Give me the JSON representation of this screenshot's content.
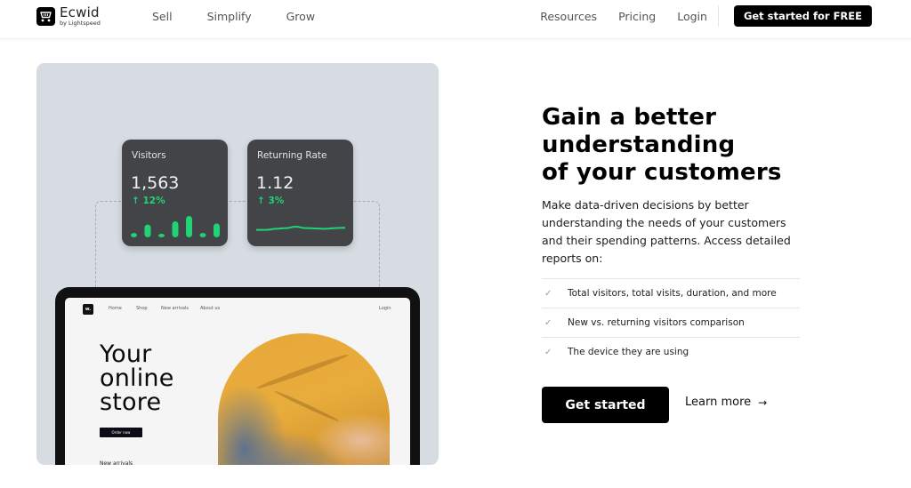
{
  "header": {
    "logo": {
      "name": "Ecwid",
      "subtitle": "by Lightspeed",
      "icon": "shopping-cart-icon"
    },
    "nav_left": [
      "Sell",
      "Simplify",
      "Grow"
    ],
    "nav_right": [
      "Resources",
      "Pricing",
      "Login"
    ],
    "cta_label": "Get started for FREE"
  },
  "illustration": {
    "cards": [
      {
        "title": "Visitors",
        "value": "1,563",
        "delta": "↑ 12%",
        "chart": "bar",
        "bar_values": [
          0.2,
          0.6,
          0.1,
          0.75,
          1.0,
          0.2,
          0.65
        ]
      },
      {
        "title": "Returning Rate",
        "value": "1.12",
        "delta": "↑ 3%",
        "chart": "line",
        "line_values": [
          0.3,
          0.3,
          0.45,
          0.55,
          0.75,
          0.55,
          0.5,
          0.45,
          0.55,
          0.6
        ]
      }
    ],
    "accent_color": "#20d374",
    "tablet": {
      "logo": "w.",
      "nav": [
        "Home",
        "Shop",
        "New arrivals",
        "About us"
      ],
      "login": "Login",
      "hero_lines": [
        "Your",
        "online",
        "store"
      ],
      "button": "Order now",
      "section": "New arrivals"
    }
  },
  "content": {
    "headline_lines": [
      "Gain a better",
      "understanding",
      "of your customers"
    ],
    "intro": "Make data-driven decisions by better understanding the needs of your customers and their spending patterns. Access detailed reports on:",
    "features": [
      "Total visitors, total visits, duration, and more",
      "New vs. returning visitors comparison",
      "The device they are using"
    ],
    "primary_button": "Get started",
    "secondary_link": "Learn more",
    "secondary_icon": "→"
  }
}
